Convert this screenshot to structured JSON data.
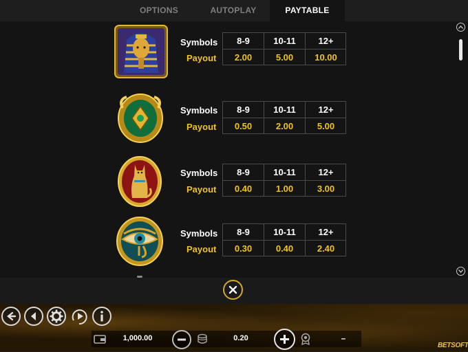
{
  "tabs": [
    {
      "label": "OPTIONS"
    },
    {
      "label": "AUTOPLAY"
    },
    {
      "label": "PAYTABLE",
      "active": true
    }
  ],
  "paytable": {
    "symbols_label": "Symbols",
    "payout_label": "Payout",
    "headers": [
      "8-9",
      "10-11",
      "12+"
    ],
    "rows": [
      {
        "symbol": "pharaoh-icon",
        "payouts": [
          "2.00",
          "5.00",
          "10.00"
        ]
      },
      {
        "symbol": "scarab-icon",
        "payouts": [
          "0.50",
          "2.00",
          "5.00"
        ]
      },
      {
        "symbol": "cat-icon",
        "payouts": [
          "0.40",
          "1.00",
          "3.00"
        ]
      },
      {
        "symbol": "eye-of-horus-icon",
        "payouts": [
          "0.30",
          "0.40",
          "2.40"
        ]
      }
    ]
  },
  "footer": {
    "balance": "1,000.00",
    "bet": "0.20",
    "win": "–",
    "brand": "BETSOFT"
  },
  "colors": {
    "accent_gold": "#f0c419",
    "panel_bg": "#141414",
    "tab_active_bg": "#141414"
  }
}
